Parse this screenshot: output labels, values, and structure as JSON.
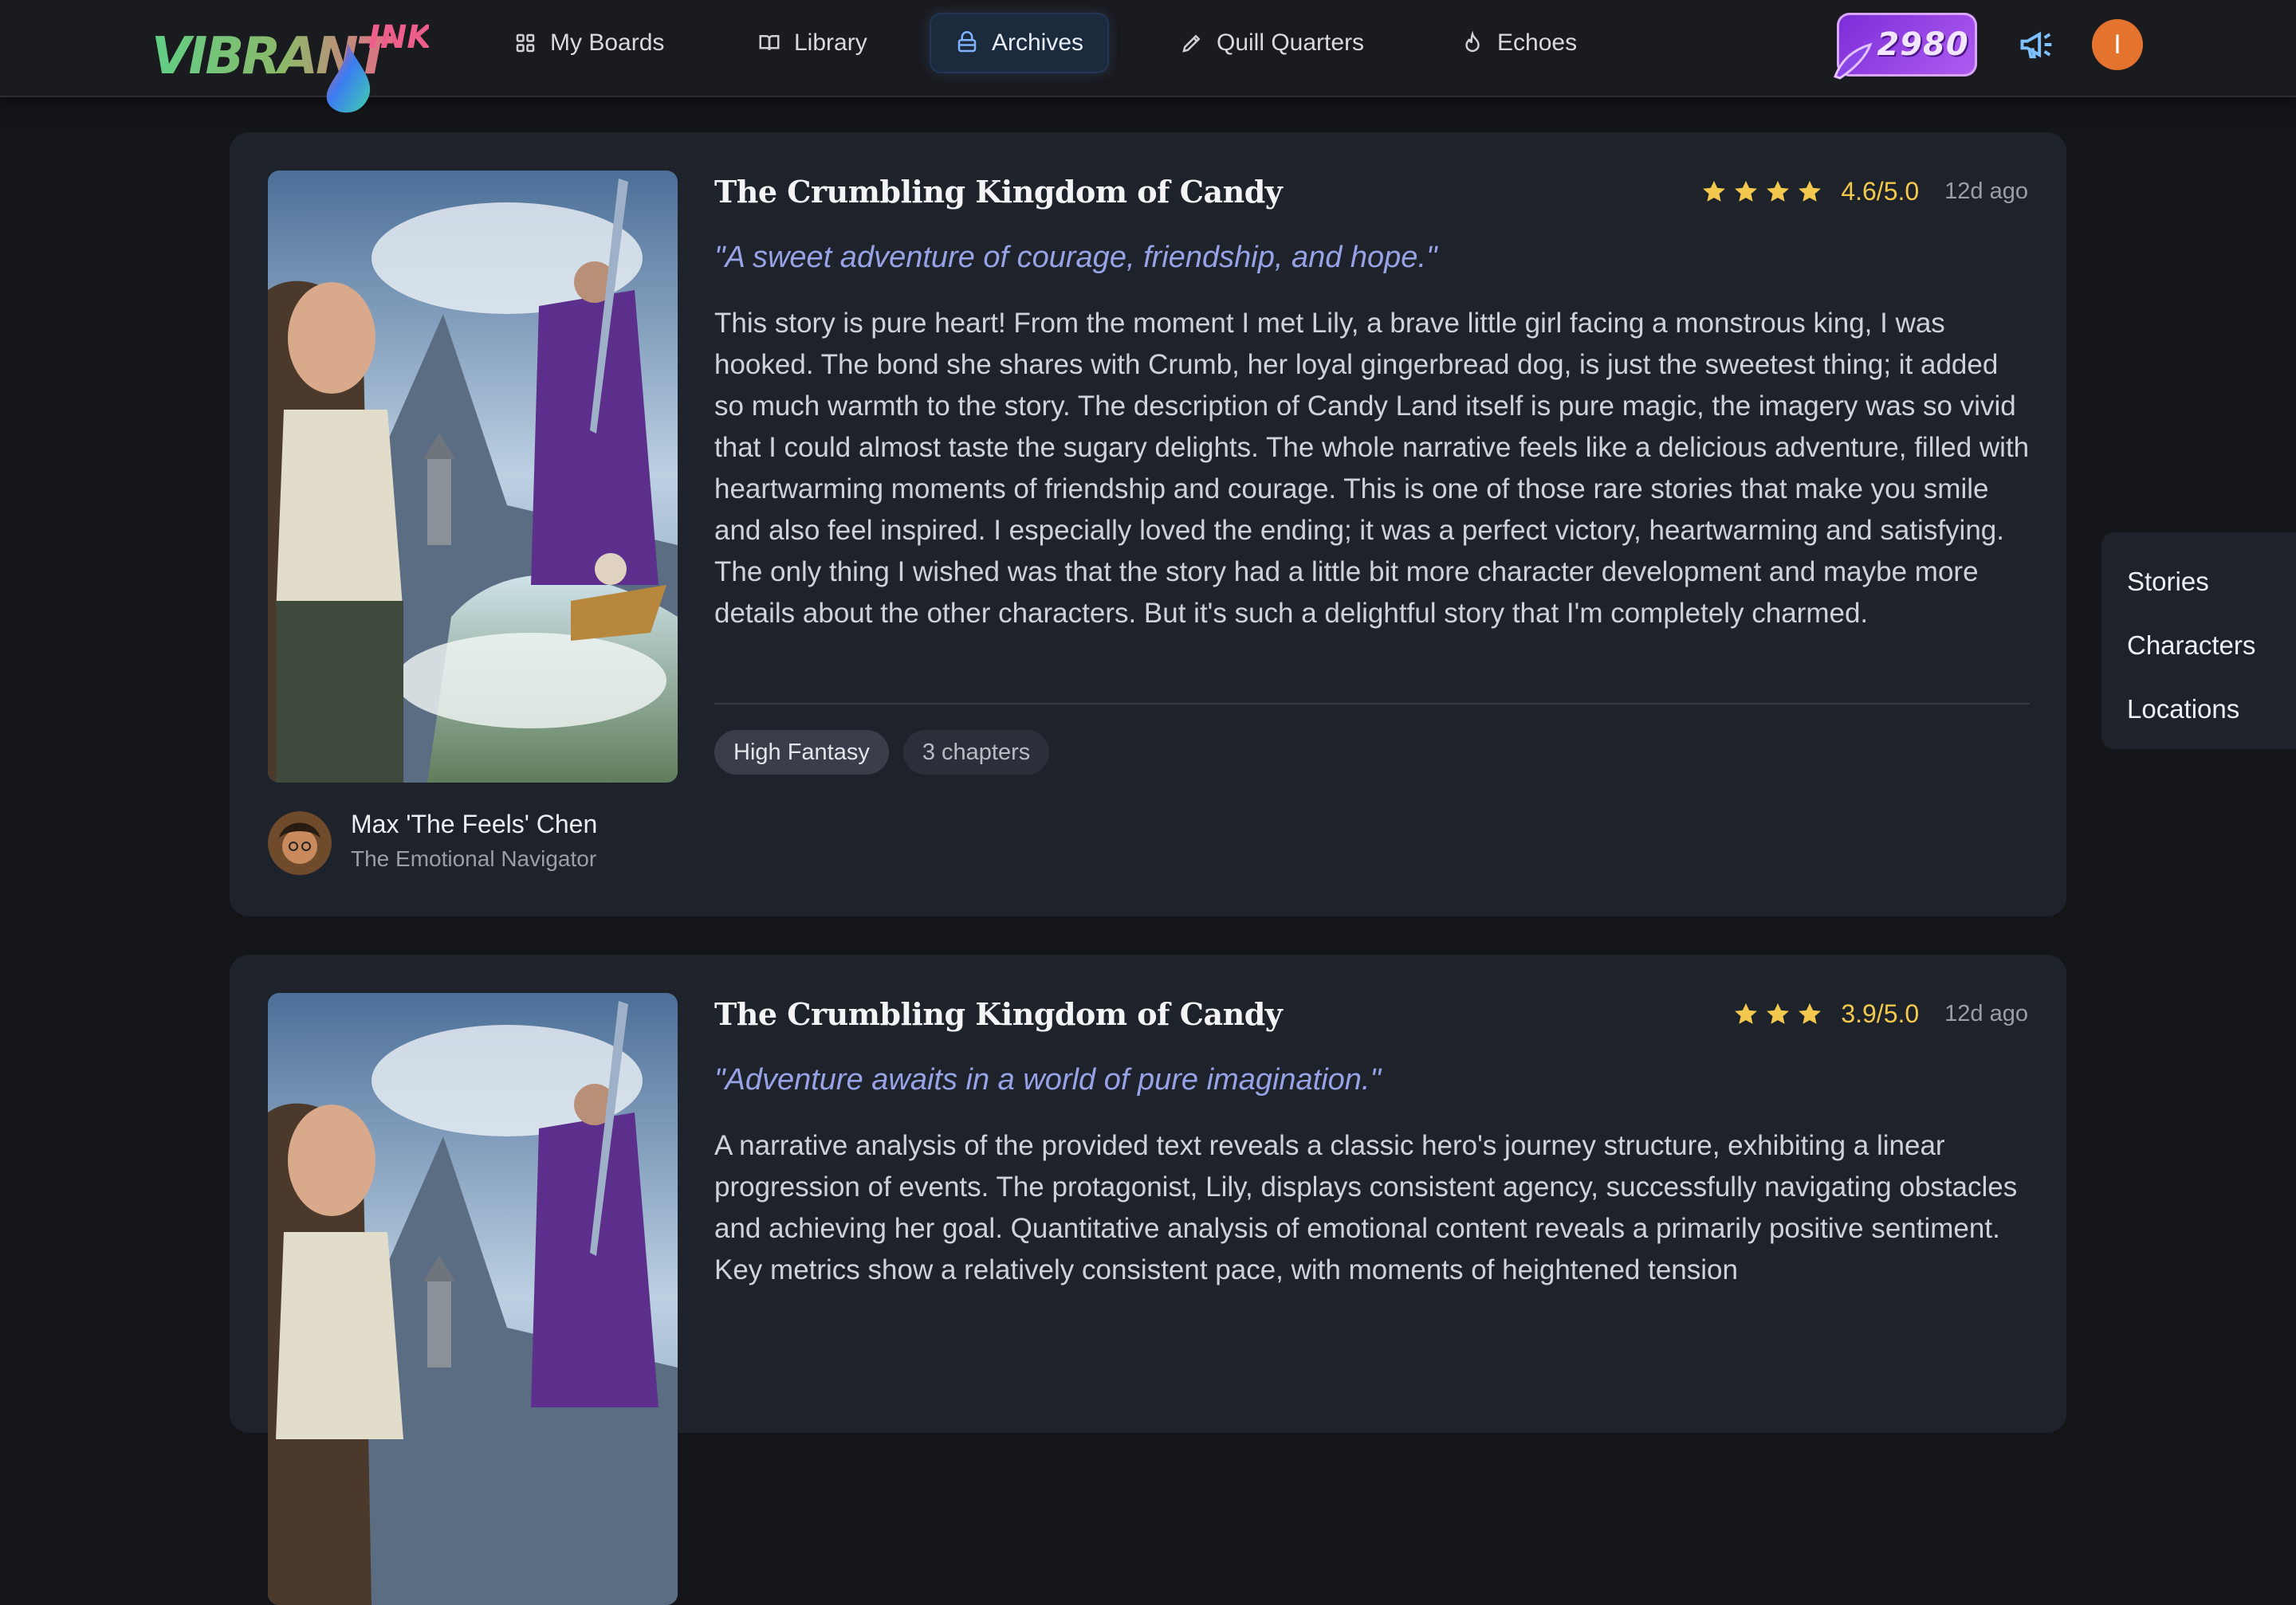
{
  "brand": {
    "logo_text_main": "VIBRANT",
    "logo_text_accent": "INK"
  },
  "nav": {
    "items": [
      {
        "label": "My Boards",
        "icon": "grid-icon"
      },
      {
        "label": "Library",
        "icon": "book-open-icon"
      },
      {
        "label": "Archives",
        "icon": "archive-icon",
        "active": true
      },
      {
        "label": "Quill Quarters",
        "icon": "pencil-icon"
      },
      {
        "label": "Echoes",
        "icon": "flame-icon"
      }
    ],
    "points": "2980",
    "user_initial": "I"
  },
  "reviews": [
    {
      "title": "The Crumbling Kingdom of Candy",
      "stars": 4,
      "score": "4.6/5.0",
      "ago": "12d ago",
      "quote": "\"A sweet adventure of courage, friendship, and hope.\"",
      "body": "This story is pure heart! From the moment I met Lily, a brave little girl facing a monstrous king, I was hooked. The bond she shares with Crumb, her loyal gingerbread dog, is just the sweetest thing; it added so much warmth to the story. The description of Candy Land itself is pure magic, the imagery was so vivid that I could almost taste the sugary delights. The whole narrative feels like a delicious adventure, filled with heartwarming moments of friendship and courage. This is one of those rare stories that make you smile and also feel inspired. I especially loved the ending; it was a perfect victory, heartwarming and satisfying. The only thing I wished was that the story had a little bit more character development and maybe more details about the other characters. But it's such a delightful story that I'm completely charmed.",
      "tags": [
        "High Fantasy",
        "3 chapters"
      ],
      "reviewer_name": "Max 'The Feels' Chen",
      "reviewer_role": "The Emotional Navigator"
    },
    {
      "title": "The Crumbling Kingdom of Candy",
      "stars": 3,
      "score": "3.9/5.0",
      "ago": "12d ago",
      "quote": "\"Adventure awaits in a world of pure imagination.\"",
      "body": "A narrative analysis of the provided text reveals a classic hero's journey structure, exhibiting a linear progression of events. The protagonist, Lily, displays consistent agency, successfully navigating obstacles and achieving her goal. Quantitative analysis of emotional content reveals a primarily positive sentiment. Key metrics show a relatively consistent pace, with moments of heightened tension"
    }
  ],
  "side_panel": {
    "items": [
      "Stories",
      "Characters",
      "Locations"
    ]
  },
  "colors": {
    "accent_purple": "#8b3ee0",
    "star_gold": "#f2c94c",
    "quote_blue": "#97a3e6",
    "card_bg": "#1e222b"
  }
}
